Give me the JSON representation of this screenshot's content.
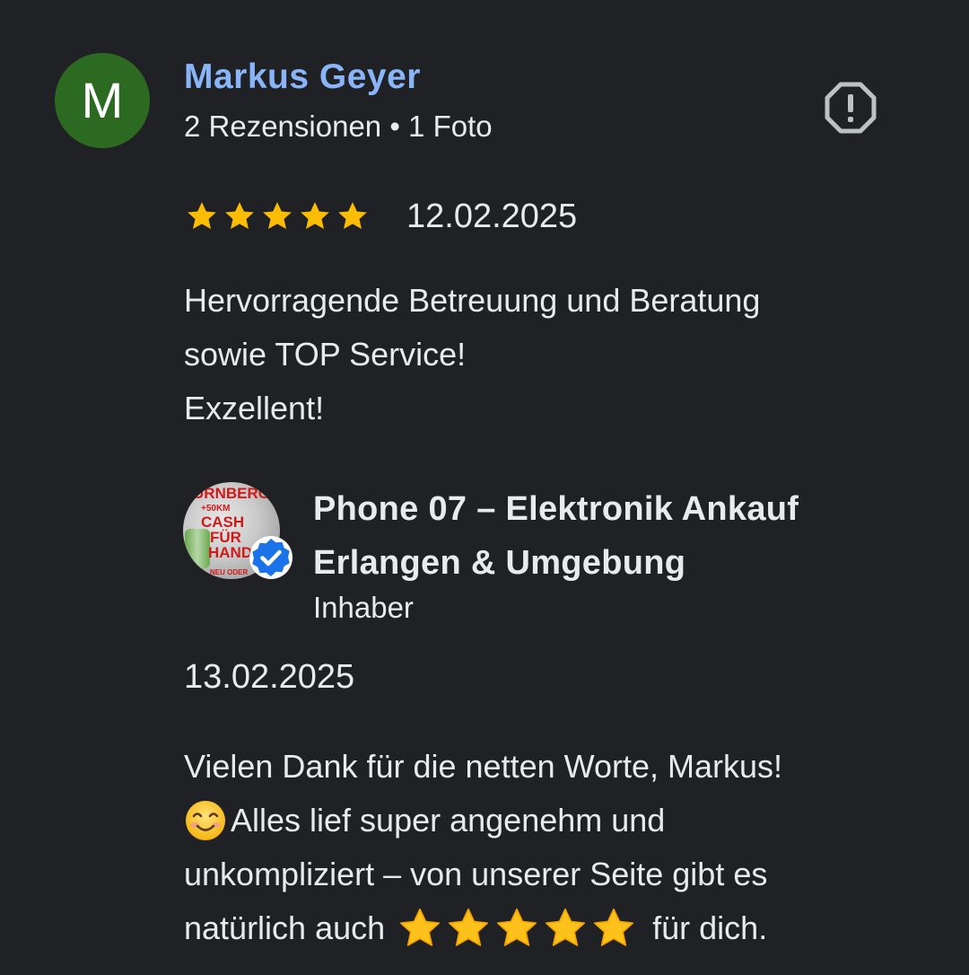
{
  "review": {
    "author": {
      "initial": "M",
      "name": "Markus Geyer",
      "meta": "2 Rezensionen • 1 Foto",
      "avatar_color": "#2d6a21"
    },
    "report_icon": "report-flag-icon",
    "rating": 5,
    "date": "12.02.2025",
    "text_lines": [
      "Hervorragende Betreuung und Beratung",
      "sowie TOP Service!",
      "Exzellent!"
    ]
  },
  "owner_response": {
    "avatar_text": {
      "banner": "ÜRNBERG",
      "sub": "+50KM",
      "cash": "CASH",
      "fuer": "FÜR",
      "hand": "HAND",
      "footer": "NEU ODER"
    },
    "name_lines": [
      "Phone 07 – Elektronik Ankauf",
      "Erlangen & Umgebung"
    ],
    "role": "Inhaber",
    "date": "13.02.2025",
    "text": {
      "line1": "Vielen Dank für die netten Worte, Markus!",
      "line2_emoji": "smiling-face-emoji",
      "line2": "Alles lief super angenehm und",
      "line3": "unkompliziert – von unserer Seite gibt es",
      "line4_before": "natürlich auch",
      "line4_star_count": 5,
      "line4_after": "für dich."
    }
  },
  "colors": {
    "background": "#202124",
    "text": "#e8eaed",
    "link": "#8ab4f8",
    "star": "#fbbc04",
    "verified": "#1a73e8"
  }
}
